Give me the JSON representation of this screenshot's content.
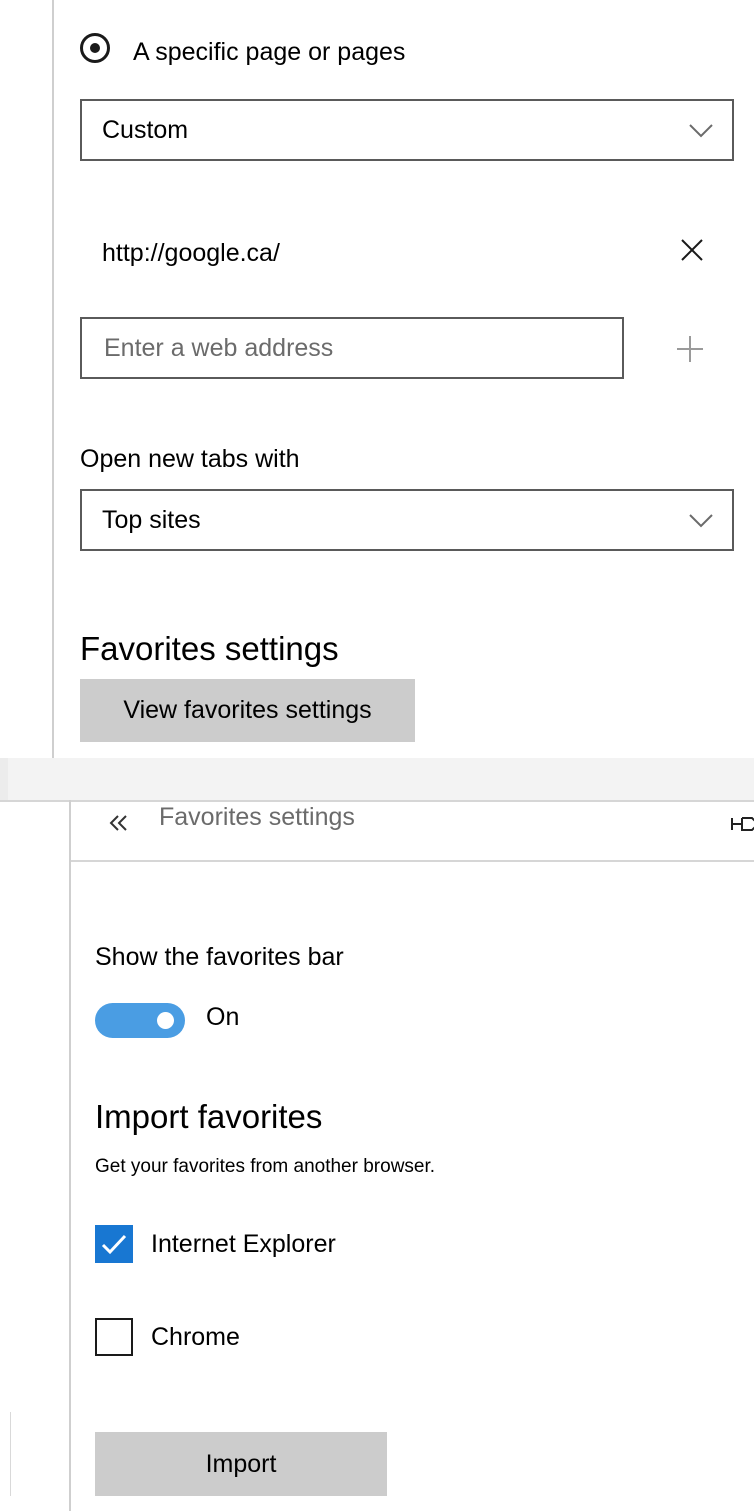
{
  "start_page": {
    "radio_label": "A specific page or pages",
    "radio_selected": true,
    "page_set_select": {
      "value": "Custom"
    },
    "urls": [
      {
        "url": "http://google.ca/"
      }
    ],
    "new_address": {
      "value": "",
      "placeholder": "Enter a web address"
    }
  },
  "new_tabs": {
    "label": "Open new tabs with",
    "select": {
      "value": "Top sites"
    }
  },
  "favorites_section": {
    "heading": "Favorites settings",
    "button_label": "View favorites settings"
  },
  "favorites_panel": {
    "back_icon": "double-chevron-left-icon",
    "title": "Favorites settings",
    "pin_icon": "pin-icon",
    "show_bar": {
      "label": "Show the favorites bar",
      "state_label": "On",
      "on": true,
      "accent": "#4a9de3"
    },
    "import": {
      "heading": "Import favorites",
      "description": "Get your favorites from another browser.",
      "browsers": [
        {
          "label": "Internet Explorer",
          "checked": true
        },
        {
          "label": "Chrome",
          "checked": false
        }
      ],
      "checkbox_accent": "#1877d2",
      "button_label": "Import"
    }
  }
}
